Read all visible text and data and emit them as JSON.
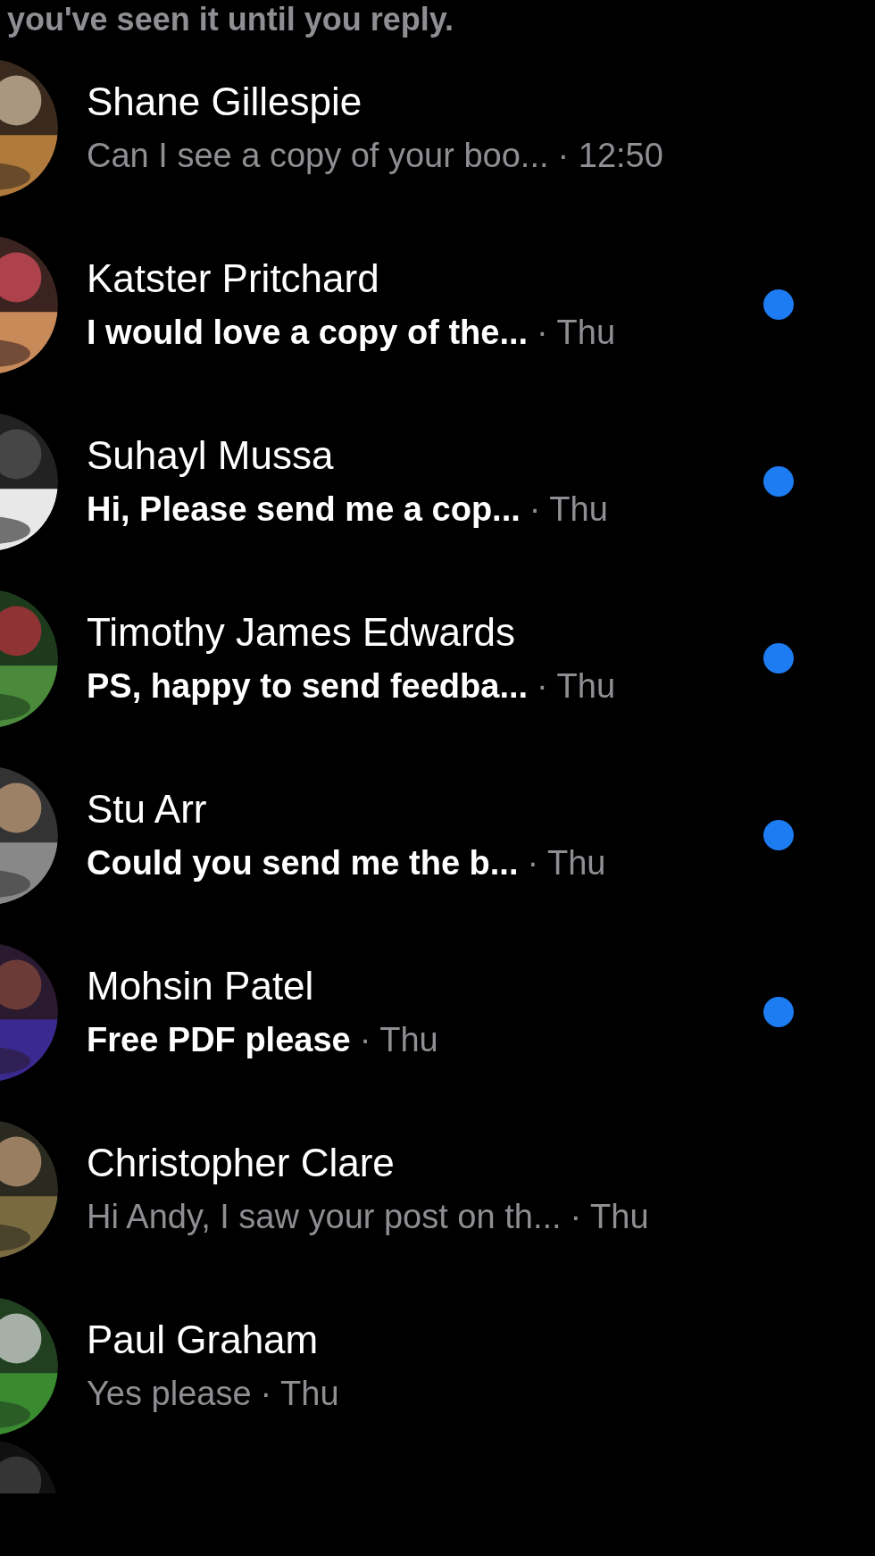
{
  "header_text": "you've seen it until you reply.",
  "conversations": [
    {
      "name": "Shane Gillespie",
      "message": "Can I see a copy of your boo...",
      "time": "· 12:50",
      "unread": false
    },
    {
      "name": "Katster Pritchard",
      "message": "I would love a copy of the...",
      "time": "· Thu",
      "unread": true
    },
    {
      "name": "Suhayl Mussa",
      "message": "Hi, Please send me a cop...",
      "time": "· Thu",
      "unread": true
    },
    {
      "name": "Timothy James Edwards",
      "message": "PS, happy to send feedba...",
      "time": "· Thu",
      "unread": true
    },
    {
      "name": "Stu Arr",
      "message": "Could you send me the b...",
      "time": "· Thu",
      "unread": true
    },
    {
      "name": "Mohsin Patel",
      "message": "Free PDF please",
      "time": "· Thu",
      "unread": true
    },
    {
      "name": "Christopher Clare",
      "message": "Hi Andy, I saw your post on th...",
      "time": "· Thu",
      "unread": false
    },
    {
      "name": "Paul Graham",
      "message": "Yes please",
      "time": "· Thu",
      "unread": false
    }
  ]
}
